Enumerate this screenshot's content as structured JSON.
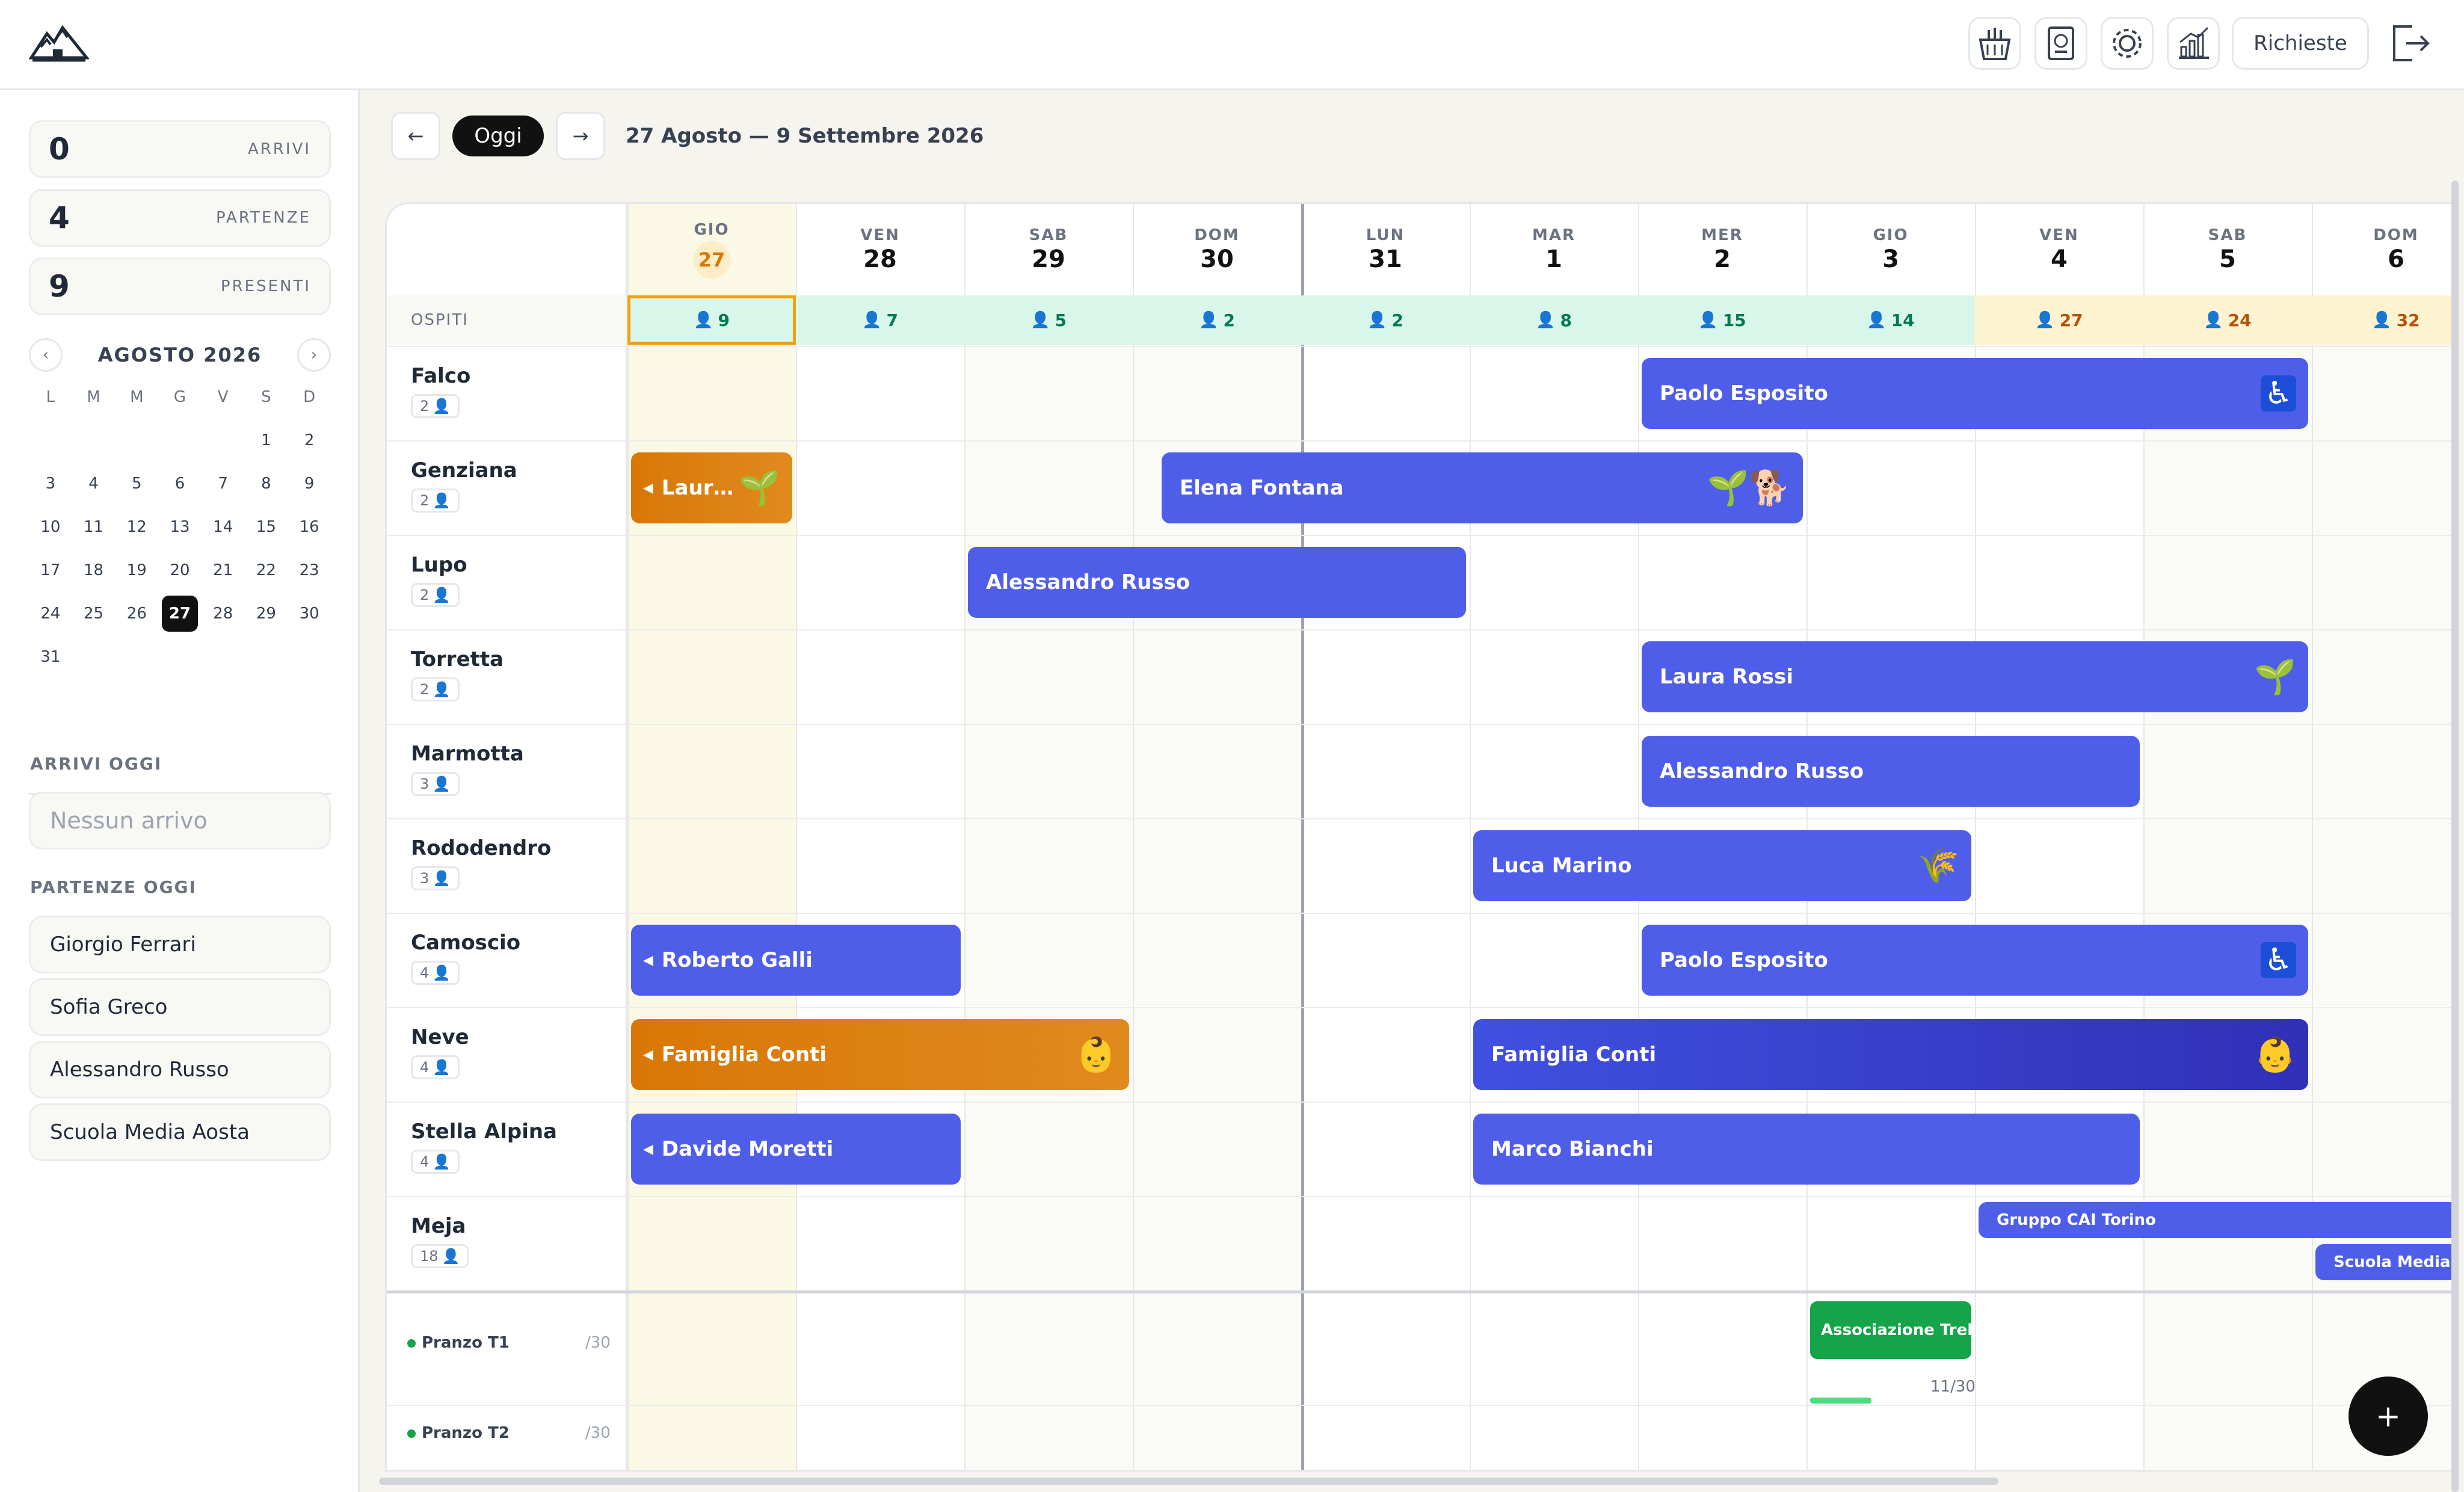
{
  "stats": [
    {
      "value": "0",
      "label": "ARRIVI"
    },
    {
      "value": "4",
      "label": "PARTENZE"
    },
    {
      "value": "9",
      "label": "PRESENTI"
    }
  ],
  "calendar": {
    "month": "AGOSTO 2026",
    "dow": [
      "L",
      "M",
      "M",
      "G",
      "V",
      "S",
      "D"
    ],
    "lead_blanks": 5,
    "days": [
      "1",
      "2",
      "3",
      "4",
      "5",
      "6",
      "7",
      "8",
      "9",
      "10",
      "11",
      "12",
      "13",
      "14",
      "15",
      "16",
      "17",
      "18",
      "19",
      "20",
      "21",
      "22",
      "23",
      "24",
      "25",
      "26",
      "27",
      "28",
      "29",
      "30",
      "31"
    ],
    "today": "27"
  },
  "arrivi_oggi": {
    "title": "ARRIVI OGGI",
    "empty": "Nessun arrivo"
  },
  "partenze_oggi": {
    "title": "PARTENZE OGGI",
    "items": [
      "Giorgio Ferrari",
      "Sofia Greco",
      "Alessandro Russo",
      "Scuola Media Aosta"
    ]
  },
  "header": {
    "requests_label": "Richieste",
    "prev": "←",
    "today": "Oggi",
    "next": "→",
    "range": "27 Agosto — 9 Settembre 2026"
  },
  "icons": {
    "shop": "basket-icon",
    "guests": "passport-icon",
    "settings": "gear-icon",
    "stats": "chart-icon",
    "logout": "logout-icon"
  },
  "days": [
    {
      "dow": "GIO",
      "num": "27",
      "guests": "9",
      "today": true
    },
    {
      "dow": "VEN",
      "num": "28",
      "guests": "7"
    },
    {
      "dow": "SAB",
      "num": "29",
      "guests": "5"
    },
    {
      "dow": "DOM",
      "num": "30",
      "guests": "2"
    },
    {
      "dow": "LUN",
      "num": "31",
      "guests": "2"
    },
    {
      "dow": "MAR",
      "num": "1",
      "guests": "8"
    },
    {
      "dow": "MER",
      "num": "2",
      "guests": "15"
    },
    {
      "dow": "GIO",
      "num": "3",
      "guests": "14"
    },
    {
      "dow": "VEN",
      "num": "4",
      "guests": "27",
      "busy": true
    },
    {
      "dow": "SAB",
      "num": "5",
      "guests": "24",
      "busy": true
    },
    {
      "dow": "DOM",
      "num": "6",
      "guests": "32",
      "busy": true
    }
  ],
  "ospiti_label": "OSPITI",
  "rooms": [
    {
      "name": "Falco",
      "cap": "2"
    },
    {
      "name": "Genziana",
      "cap": "2"
    },
    {
      "name": "Lupo",
      "cap": "2"
    },
    {
      "name": "Torretta",
      "cap": "2"
    },
    {
      "name": "Marmotta",
      "cap": "3"
    },
    {
      "name": "Rododendro",
      "cap": "3"
    },
    {
      "name": "Camoscio",
      "cap": "4"
    },
    {
      "name": "Neve",
      "cap": "4"
    },
    {
      "name": "Stella Alpina",
      "cap": "4"
    },
    {
      "name": "Meja",
      "cap": "18"
    }
  ],
  "bookings": [
    {
      "room": 0,
      "start": 6,
      "end": 10,
      "label": "Paolo Esposito",
      "icon": "♿",
      "icon_name": "wheelchair-icon"
    },
    {
      "room": 1,
      "start": 0,
      "end": 1,
      "label": "Laur…",
      "icon": "🌱",
      "icon_name": "vegan-icon",
      "orange": true,
      "cont": true
    },
    {
      "room": 1,
      "start": 3.15,
      "end": 7,
      "label": "Elena Fontana",
      "icon": "🌱🐕",
      "icon_name": "vegan-dog-icon"
    },
    {
      "room": 2,
      "start": 2,
      "end": 5,
      "label": "Alessandro Russo"
    },
    {
      "room": 3,
      "start": 6,
      "end": 10,
      "label": "Laura Rossi",
      "icon": "🌱",
      "icon_name": "vegan-icon"
    },
    {
      "room": 4,
      "start": 6,
      "end": 9,
      "label": "Alessandro Russo"
    },
    {
      "room": 5,
      "start": 5,
      "end": 8,
      "label": "Luca Marino",
      "icon": "🌾",
      "icon_name": "gluten-icon"
    },
    {
      "room": 6,
      "start": 0,
      "end": 2,
      "label": "Roberto Galli",
      "cont": true
    },
    {
      "room": 6,
      "start": 6,
      "end": 10,
      "label": "Paolo Esposito",
      "icon": "♿",
      "icon_name": "wheelchair-icon"
    },
    {
      "room": 7,
      "start": 0,
      "end": 3,
      "label": "Famiglia Conti",
      "icon": "👶",
      "icon_name": "baby-icon",
      "orange": true,
      "cont": true
    },
    {
      "room": 7,
      "start": 5,
      "end": 10,
      "label": "Famiglia Conti",
      "icon": "👶",
      "icon_name": "baby-icon",
      "dark": true
    },
    {
      "room": 8,
      "start": 0,
      "end": 2,
      "label": "Davide Moretti",
      "cont": true
    },
    {
      "room": 8,
      "start": 5,
      "end": 9,
      "label": "Marco Bianchi"
    }
  ],
  "meja_bookings": [
    {
      "start": 8,
      "end": 11,
      "label": "Gruppo CAI Torino",
      "lane": 0
    },
    {
      "start": 10,
      "end": 11,
      "label": "Scuola Media Aos",
      "lane": 1
    }
  ],
  "meals": [
    {
      "name": "Pranzo T1",
      "max": "/30"
    },
    {
      "name": "Pranzo T2",
      "max": "/30"
    }
  ],
  "meal_booking": {
    "label": "Associazione Trekki",
    "count": "11/30",
    "day": 7
  },
  "fab": "+"
}
